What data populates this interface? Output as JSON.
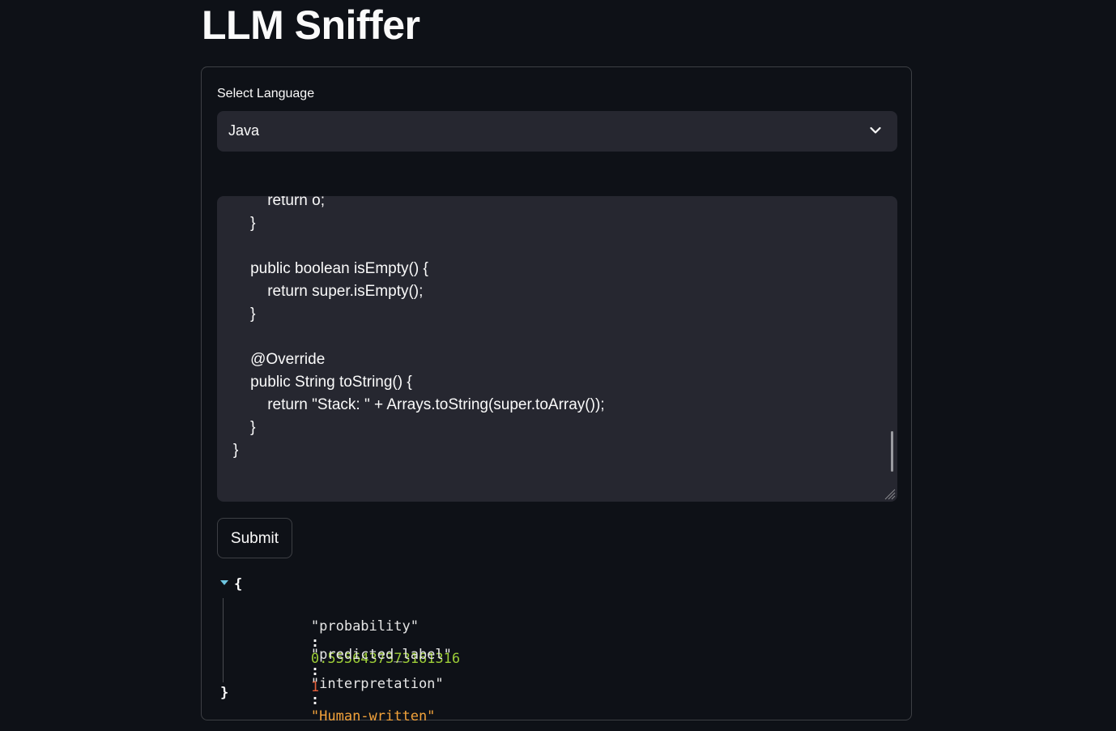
{
  "title": "LLM Sniffer",
  "form": {
    "select": {
      "label": "Select Language",
      "value": "Java"
    },
    "code_input": {
      "lines": [
        "        return o;",
        "    }",
        "",
        "    public boolean isEmpty() {",
        "        return super.isEmpty();",
        "    }",
        "",
        "    @Override",
        "    public String toString() {",
        "        return \"Stack: \" + Arrays.toString(super.toArray());",
        "    }",
        "}"
      ]
    },
    "submit_label": "Submit"
  },
  "result": {
    "open_brace": "{",
    "close_brace": "}",
    "separator": ":",
    "entries": [
      {
        "key": "\"probability\"",
        "value": "0.5556437373161316"
      },
      {
        "key": "\"predicted_label\"",
        "value": "1"
      },
      {
        "key": "\"interpretation\"",
        "value": "\"Human-written\""
      }
    ]
  },
  "colors": {
    "background": "#0e1117",
    "widget": "#262730",
    "number": "#9ccc37",
    "integer": "#e55f3a",
    "string": "#f2a23a"
  },
  "icons": [
    "chevron-down-icon",
    "resize-handle-icon",
    "collapse-triangle-icon"
  ]
}
